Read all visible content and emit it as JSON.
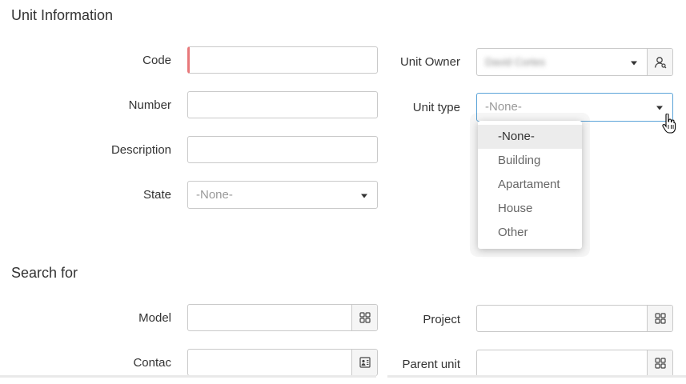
{
  "sections": {
    "unit_info_title": "Unit Information",
    "search_for_title": "Search for"
  },
  "fields": {
    "code": {
      "label": "Code",
      "value": ""
    },
    "number": {
      "label": "Number",
      "value": ""
    },
    "description": {
      "label": "Description",
      "value": ""
    },
    "state": {
      "label": "State",
      "value": "-None-"
    },
    "unit_owner": {
      "label": "Unit Owner",
      "value": "David Cortes"
    },
    "unit_type": {
      "label": "Unit type",
      "value": "-None-"
    },
    "model": {
      "label": "Model",
      "value": ""
    },
    "contac": {
      "label": "Contac",
      "value": ""
    },
    "project": {
      "label": "Project",
      "value": ""
    },
    "parent_unit": {
      "label": "Parent unit",
      "value": ""
    }
  },
  "unit_type_dropdown": {
    "options": [
      "-None-",
      "Building",
      "Apartament",
      "House",
      "Other"
    ],
    "selected": "-None-"
  },
  "icons": {
    "owner_button": "user-search-icon",
    "model_button": "grid-icon",
    "contac_button": "contact-card-icon",
    "project_button": "grid-icon",
    "parent_unit_button": "grid-icon",
    "pointer": "hand-pointer-icon"
  },
  "colors": {
    "required_marker": "#e8787a",
    "focus_border": "#5aa3d8",
    "border": "#c9c9c9"
  }
}
